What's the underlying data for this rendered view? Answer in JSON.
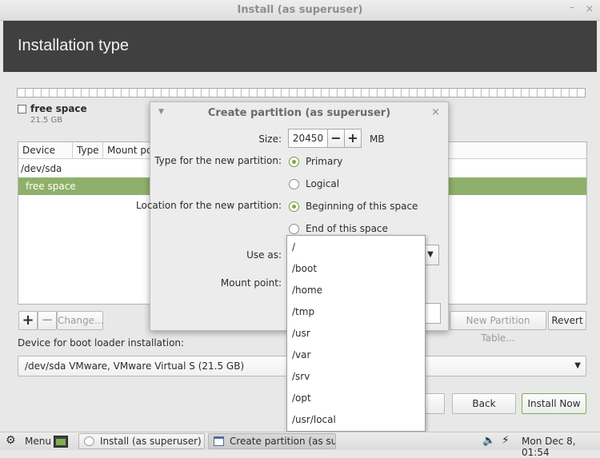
{
  "window": {
    "title": "Install (as superuser)",
    "minimize_glyph": "–",
    "close_glyph": "×"
  },
  "header": {
    "title": "Installation type"
  },
  "legend": {
    "label": "free space",
    "size": "21.5 GB"
  },
  "table": {
    "columns": [
      "Device",
      "Type",
      "Mount poi"
    ],
    "rows": [
      {
        "device": "/dev/sda"
      },
      {
        "device": "free space",
        "selected": true
      }
    ]
  },
  "toolbar": {
    "add_label": "+",
    "remove_label": "−",
    "change_label": "Change...",
    "new_table_label": "New Partition Table...",
    "revert_label": "Revert"
  },
  "boot": {
    "label": "Device for boot loader installation:",
    "value": "/dev/sda VMware, VMware Virtual S (21.5 GB)"
  },
  "buttons": {
    "back_label": "Back",
    "install_label": "Install Now"
  },
  "dialog": {
    "title": "Create partition (as superuser)",
    "close_glyph": "×",
    "size_label": "Size:",
    "size_value": "20450",
    "size_minus": "−",
    "size_plus": "+",
    "size_unit": "MB",
    "type_label": "Type for the new partition:",
    "type_options": [
      "Primary",
      "Logical"
    ],
    "type_selected": "Primary",
    "location_label": "Location for the new partition:",
    "location_options": [
      "Beginning of this space",
      "End of this space"
    ],
    "location_selected": "Beginning of this space",
    "use_as_label": "Use as:",
    "mount_label": "Mount point:"
  },
  "mount_dropdown": {
    "items": [
      "/",
      "/boot",
      "/home",
      "/tmp",
      "/usr",
      "/var",
      "/srv",
      "/opt",
      "/usr/local"
    ]
  },
  "taskbar": {
    "menu_label": "Menu",
    "tasks": [
      "Install (as superuser)",
      "Create partition (as su..."
    ],
    "clock": "Mon Dec  8, 01:54"
  },
  "colors": {
    "header_bg": "#404040",
    "selection_green": "#8fb06a",
    "accent_green": "#7ca94a"
  },
  "icons": [
    "gear-icon",
    "terminal-icon",
    "volume-icon",
    "network-icon",
    "chevron-down-icon",
    "close-icon"
  ]
}
